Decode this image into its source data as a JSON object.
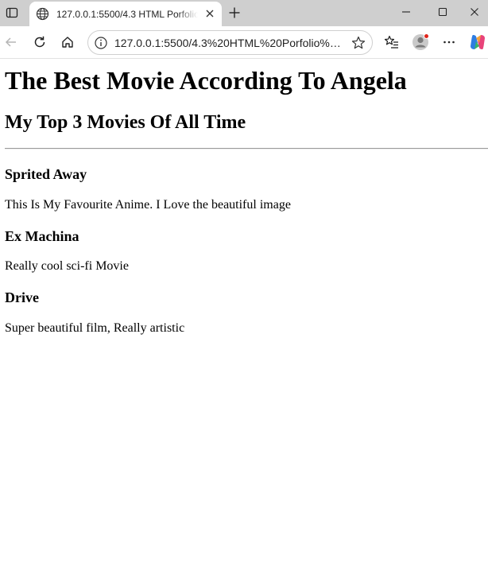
{
  "browser": {
    "tab": {
      "title": "127.0.0.1:5500/4.3 HTML Porfolio"
    },
    "address": {
      "url": "127.0.0.1:5500/4.3%20HTML%20Porfolio%20..."
    },
    "icons": {
      "tab_actions": "tab-actions-icon",
      "favicon": "globe-icon",
      "close_tab": "close-icon",
      "new_tab": "plus-icon",
      "minimize": "minimize-icon",
      "maximize": "maximize-icon",
      "close_window": "close-icon",
      "back": "back-arrow-icon",
      "reload": "reload-icon",
      "home": "home-icon",
      "site_info": "info-icon",
      "favorite": "star-icon",
      "favorites": "favorites-icon",
      "profile": "profile-icon",
      "more": "more-icon",
      "copilot": "copilot-icon"
    },
    "colors": {
      "tabstrip": "#cfcfcf",
      "profile_badge": "#e0251b"
    }
  },
  "page": {
    "heading": "The Best Movie According To Angela",
    "subheading": "My Top 3 Movies Of All Time",
    "movies": [
      {
        "title": "Sprited Away",
        "description": "This Is My Favourite Anime. I Love the beautiful image"
      },
      {
        "title": "Ex Machina",
        "description": "Really cool sci-fi Movie"
      },
      {
        "title": "Drive",
        "description": "Super beautiful film, Really artistic"
      }
    ]
  }
}
